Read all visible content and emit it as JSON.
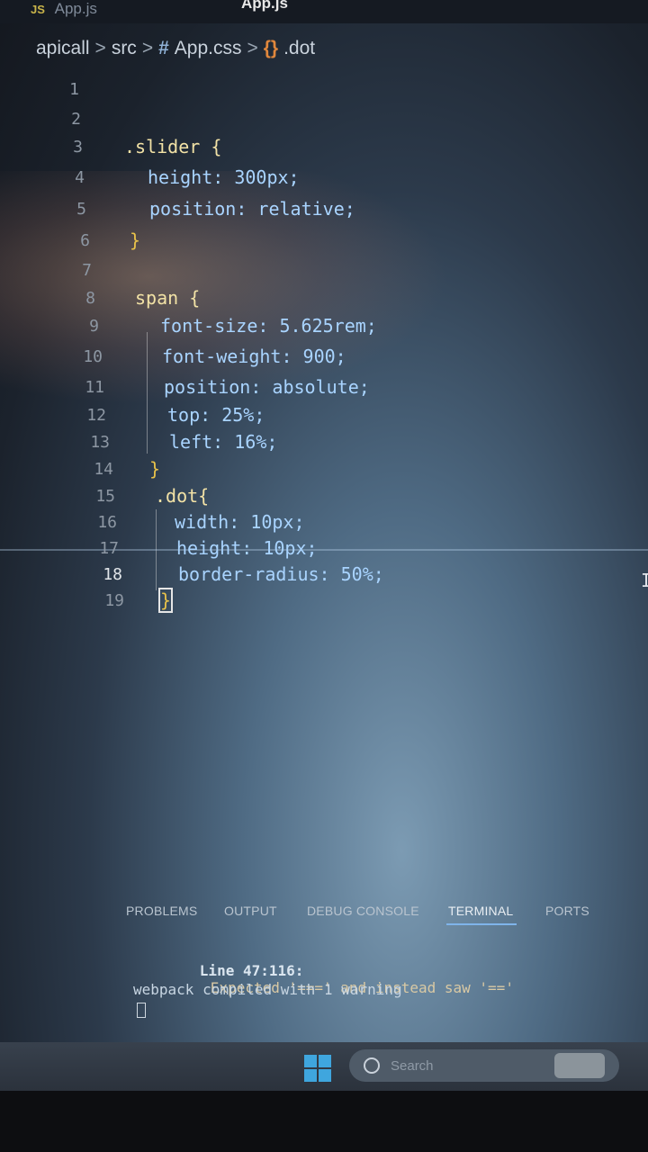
{
  "tabs": {
    "inactive_badge": "JS",
    "inactive_label": "App.js",
    "active_label": "App.js"
  },
  "breadcrumb": {
    "project": "apicall",
    "sep": ">",
    "folder": "src",
    "hash": "#",
    "file": "App.css",
    "symbol_icon": "{}",
    "symbol": ".dot"
  },
  "editor": {
    "lines": [
      {
        "n": "1"
      },
      {
        "n": "2"
      },
      {
        "n": "3",
        "t": ".slider {"
      },
      {
        "n": "4",
        "t": "height: 300px;"
      },
      {
        "n": "5",
        "t": "position: relative;"
      },
      {
        "n": "6",
        "t": "}"
      },
      {
        "n": "7"
      },
      {
        "n": "8",
        "t": "span {"
      },
      {
        "n": "9",
        "t": "font-size: 5.625rem;"
      },
      {
        "n": "10",
        "t": "font-weight: 900;"
      },
      {
        "n": "11",
        "t": "position: absolute;"
      },
      {
        "n": "12",
        "t": "top: 25%;"
      },
      {
        "n": "13",
        "t": "left: 16%;"
      },
      {
        "n": "14",
        "t": "}"
      },
      {
        "n": "15",
        "t": ".dot{"
      },
      {
        "n": "16",
        "t": "width: 10px;"
      },
      {
        "n": "17",
        "t": "height: 10px;"
      },
      {
        "n": "18",
        "t": "border-radius: 50%;"
      },
      {
        "n": "19",
        "t": "}"
      }
    ]
  },
  "panel": {
    "tabs": [
      "PROBLEMS",
      "OUTPUT",
      "DEBUG CONSOLE",
      "TERMINAL",
      "PORTS"
    ],
    "active_tab": "TERMINAL",
    "terminal": {
      "line1_prefix": "Line 47:116:",
      "line1_msg": "Expected '===' and instead saw '=='",
      "line2": "webpack compiled with 1 warning"
    }
  },
  "taskbar": {
    "search_placeholder": "Search"
  }
}
